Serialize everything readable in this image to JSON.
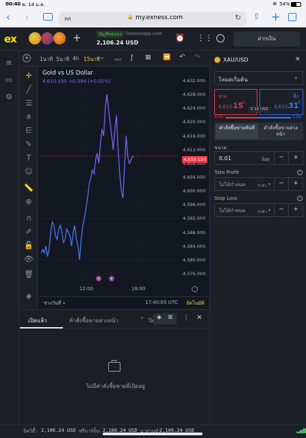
{
  "status": {
    "time": "00:40",
    "date": "พ. 14 ม.ค.",
    "battery": "54%"
  },
  "browser": {
    "reader_label": "กก",
    "url": "my.exness.com"
  },
  "header": {
    "account_type": "บัญชีทดลอง",
    "server": "forexonapp.com",
    "balance": "2,106.24 USD",
    "deposit_label": "ฝากเงิน"
  },
  "timeframes": [
    "1นาที",
    "5นาที",
    "4h",
    "15นาที"
  ],
  "chart_info": {
    "title": "Gold vs US Dollar",
    "price": "4,610.150",
    "change": "+0.394",
    "change_pct": "(+0.01%)",
    "current_price_label": "4,610.150",
    "range_label": "ช่วงวันที่",
    "clock": "17:40:05 UTC",
    "auto_label": "อัตโนมัติ"
  },
  "chart_data": {
    "type": "line",
    "title": "Gold vs US Dollar",
    "y_ticks": [
      "4,632.000",
      "4,628.000",
      "4,624.000",
      "4,620.000",
      "4,616.000",
      "4,612.000",
      "4,608.000",
      "4,604.000",
      "4,600.000",
      "4,596.000",
      "4,592.000",
      "4,588.000",
      "4,584.000",
      "4,580.000",
      "4,576.000"
    ],
    "x_ticks": [
      "12:00",
      "18:00"
    ],
    "ylim": [
      4574,
      4634
    ],
    "colors": {
      "line_low": "#3f7ef0",
      "line_high": "#8c5cf3",
      "price_tag": "#f23645"
    },
    "series": [
      {
        "values": [
          4582,
          4583,
          4582,
          4584,
          4581,
          4583,
          4588,
          4591,
          4590,
          4587,
          4586,
          4589,
          4590,
          4588,
          4585,
          4586,
          4589,
          4588,
          4587,
          4584,
          4588,
          4590,
          4586,
          4584,
          4580,
          4586,
          4590,
          4592,
          4595,
          4598,
          4602,
          4604,
          4606,
          4605,
          4609,
          4611,
          4608,
          4614,
          4618,
          4616,
          4624,
          4628,
          4624,
          4620,
          4616,
          4612,
          4618,
          4622,
          4612,
          4605,
          4600,
          4598,
          4607,
          4616,
          4610,
          4608,
          4609,
          4610,
          4610.15
        ]
      }
    ]
  },
  "bottom_tabs": [
    "เปิดแล้ว",
    "คำสั่งซื้อขายล่วงหน้า",
    "ปิด"
  ],
  "empty_state": "ไม่มีคำสั่งซื้อขายที่เปิดอยู่",
  "order_panel": {
    "symbol": "XAU/USD",
    "mode": "โหมดเริ่มต้น",
    "sell_label": "ขาย",
    "sell_price_small": "4,610.",
    "sell_price_big": "15",
    "sell_price_sup": "0",
    "buy_label": "ซื้อ",
    "buy_price_small": "4,610.",
    "buy_price_big": "31",
    "buy_price_sup": "0",
    "spread": "0.16 USD",
    "sentiment_sell": "47%",
    "sentiment_buy": "53%",
    "order_type_market": "คำสั่งซื้อขายทันที",
    "order_type_pending": "คำสั่งซื้อขายล่วงหน้า",
    "volume_label": "ขนาด",
    "volume_value": "0.01",
    "volume_unit": "ล็อต",
    "tp_label": "Take Profit",
    "tp_value": "ไม่ได้กำหนด",
    "tp_unit": "ราคา",
    "sl_label": "Stop Loss",
    "sl_value": "ไม่ได้กำหนด",
    "sl_unit": "ราคา"
  },
  "footer": {
    "equity_label": "อิควิตี้:",
    "equity_value": "2,106.24 USD",
    "free_margin_label": "ฟรีมาร์จิ้น:",
    "free_margin_value": "2,106.24 USD",
    "balance_label": "บาลานซ์:",
    "balance_value": "2,106.24 USD"
  }
}
